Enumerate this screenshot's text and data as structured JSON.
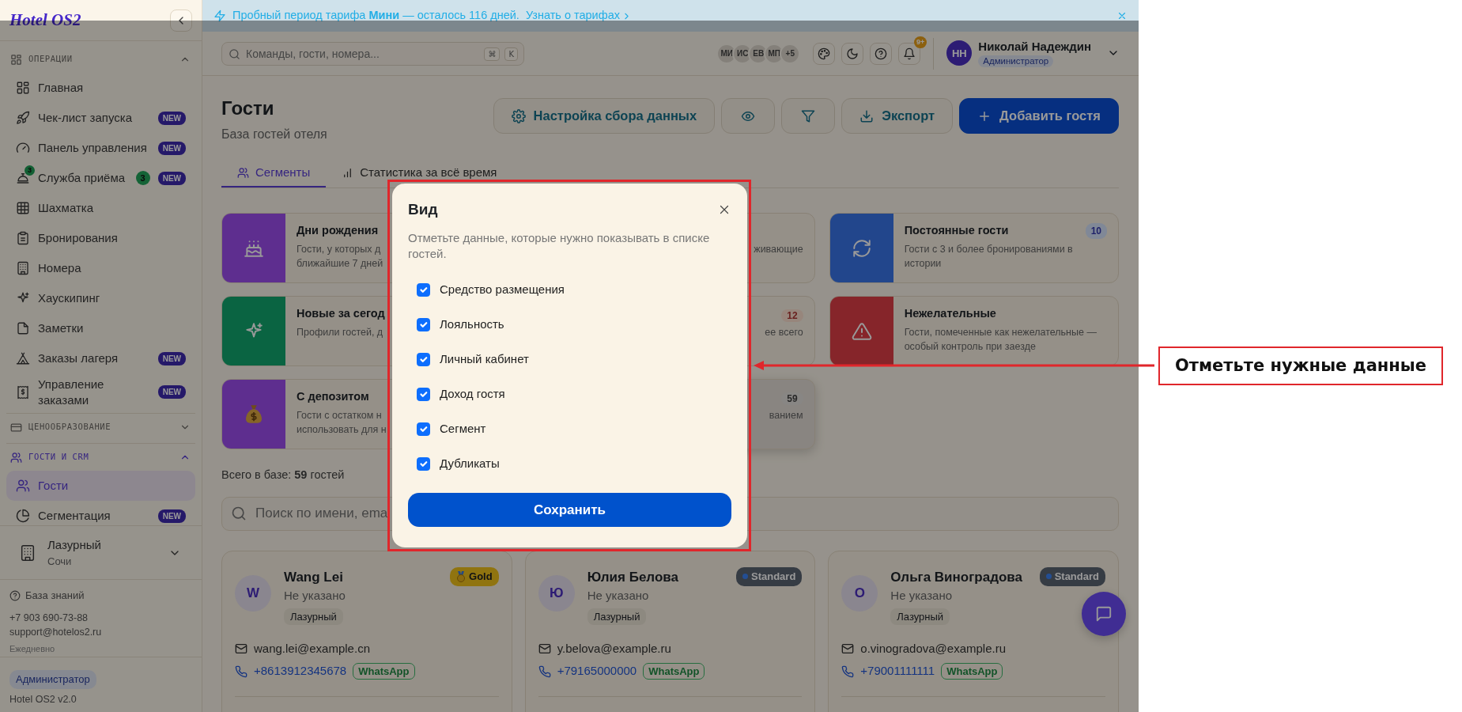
{
  "sidebar": {
    "logo": "Hotel OS2",
    "sections": [
      {
        "title": "ОПЕРАЦИИ",
        "expanded": true,
        "selected": false,
        "items": [
          {
            "label": "Главная",
            "selected": false
          },
          {
            "label": "Чек-лист запуска",
            "selected": false,
            "tag": "NEW"
          },
          {
            "label": "Панель управления",
            "selected": false,
            "tag": "NEW"
          },
          {
            "label": "Служба приёма",
            "selected": false,
            "icon_badge": "3",
            "count": "3",
            "tag": "NEW"
          },
          {
            "label": "Шахматка",
            "selected": false
          },
          {
            "label": "Бронирования",
            "selected": false
          },
          {
            "label": "Номера",
            "selected": false
          },
          {
            "label": "Хаускипинг",
            "selected": false
          },
          {
            "label": "Заметки",
            "selected": false
          },
          {
            "label": "Заказы лагеря",
            "selected": false,
            "tag": "NEW"
          },
          {
            "label": "Управление заказами",
            "selected": false,
            "tag": "NEW"
          }
        ]
      },
      {
        "title": "ЦЕНООБРАЗОВАНИЕ",
        "expanded": false,
        "selected": false
      },
      {
        "title": "ГОСТИ И CRM",
        "expanded": true,
        "selected": true,
        "items": [
          {
            "label": "Гости",
            "selected": true
          },
          {
            "label": "Сегментация",
            "selected": false,
            "tag": "NEW"
          }
        ]
      }
    ],
    "property": {
      "name": "Лазурный",
      "city": "Сочи"
    },
    "help": {
      "link": "База знаний",
      "phone": "+7 903 690-73-88",
      "email": "support@hotelos2.ru",
      "hours": "Ежедневно"
    },
    "role": "Администратор",
    "version": "Hotel OS2 v2.0"
  },
  "banner": {
    "message": "Пробный период тарифа **Мини** — осталось 116 дней.",
    "link": "Узнать о тарифах"
  },
  "topbar": {
    "search": {
      "placeholder": "Команды, гости, номера...",
      "keys": [
        "⌘",
        "K"
      ]
    },
    "online_users": [
      "МИ",
      "ИС",
      "ЕВ",
      "МП"
    ],
    "more_users": "+5",
    "notifications": "9+",
    "user": {
      "initials": "НН",
      "name": "Николай Надеждин",
      "role": "Администратор"
    }
  },
  "page": {
    "title": "Гости",
    "subtitle": "База гостей отеля",
    "actions": [
      {
        "kind": "text",
        "label": "Настройка сбора данных"
      },
      {
        "kind": "icon"
      },
      {
        "kind": "icon"
      },
      {
        "kind": "text",
        "label": "Экспорт"
      },
      {
        "kind": "primary",
        "label": "Добавить гостя"
      }
    ]
  },
  "tabs": [
    {
      "label": "Сегменты",
      "selected": true
    },
    {
      "label": "Статистика за всё время",
      "selected": false
    }
  ],
  "segments": [
    {
      "kind": "full",
      "selected": false,
      "color": "#5e2f8f",
      "title": "Дни рождения",
      "desc_lines": [
        "Гости, у которых д",
        "ближайшие 7 дней"
      ]
    },
    {
      "kind": "partial",
      "selected": false,
      "desc_lines": [
        "живающие"
      ]
    },
    {
      "kind": "full",
      "selected": false,
      "color": "#23468c",
      "title": "Постоянные гости",
      "badge": {
        "text": "10",
        "color": "#808897"
      },
      "desc_lines": [
        "Гости с 3 и более бронированиями в",
        "истории"
      ]
    },
    {
      "kind": "full",
      "selected": false,
      "color": "#0a6442",
      "title": "Новые за сегод",
      "desc_lines": [
        "Профили гостей, д"
      ]
    },
    {
      "kind": "partial",
      "selected": false,
      "badge": {
        "text": "12",
        "color": "#97867c"
      },
      "desc_lines": [
        "ее всего"
      ]
    },
    {
      "kind": "full",
      "selected": false,
      "color": "#86262a",
      "title": "Нежелательные",
      "desc_lines": [
        "Гости, помеченные как нежелательные —",
        "особый контроль при заезде"
      ]
    },
    {
      "kind": "full",
      "selected": false,
      "color": "#5e2f8f",
      "title": "С депозитом",
      "desc_lines": [
        "Гости с остатком н",
        "использовать для н"
      ]
    },
    {
      "kind": "partial",
      "selected": true,
      "badge": {
        "text": "59",
        "color": "#888684"
      },
      "desc_lines": [
        "ванием"
      ]
    }
  ],
  "total": "Всего в базе: **59** гостей",
  "guest_search": {
    "placeholder": "Поиск по имени, ema"
  },
  "guests": [
    {
      "initial": "W",
      "name": "Wang Lei",
      "property": "Не указано",
      "tag": "Лазурный",
      "tier": {
        "kind": "gold",
        "label": "Gold"
      },
      "email": "wang.lei@example.cn",
      "phone": "+8613912345678",
      "messenger": "WhatsApp"
    },
    {
      "initial": "Ю",
      "name": "Юлия Белова",
      "property": "Не указано",
      "tag": "Лазурный",
      "tier": {
        "kind": "standard",
        "label": "Standard"
      },
      "email": "y.belova@example.ru",
      "phone": "+79165000000",
      "messenger": "WhatsApp"
    },
    {
      "initial": "О",
      "name": "Ольга Виноградова",
      "property": "Не указано",
      "tag": "Лазурный",
      "tier": {
        "kind": "standard",
        "label": "Standard"
      },
      "email": "o.vinogradova@example.ru",
      "phone": "+79001111111",
      "messenger": "WhatsApp"
    }
  ],
  "modal": {
    "title": "Вид",
    "description": "Отметьте данные, которые нужно показывать в списке гостей.",
    "options": [
      {
        "label": "Средство размещения",
        "checked": true
      },
      {
        "label": "Лояльность",
        "checked": true
      },
      {
        "label": "Личный кабинет",
        "checked": true
      },
      {
        "label": "Доход гостя",
        "checked": true
      },
      {
        "label": "Сегмент",
        "checked": true
      },
      {
        "label": "Дубликаты",
        "checked": true
      }
    ],
    "save": "Сохранить"
  },
  "annotation": {
    "text": "Отметьте нужные данные"
  }
}
